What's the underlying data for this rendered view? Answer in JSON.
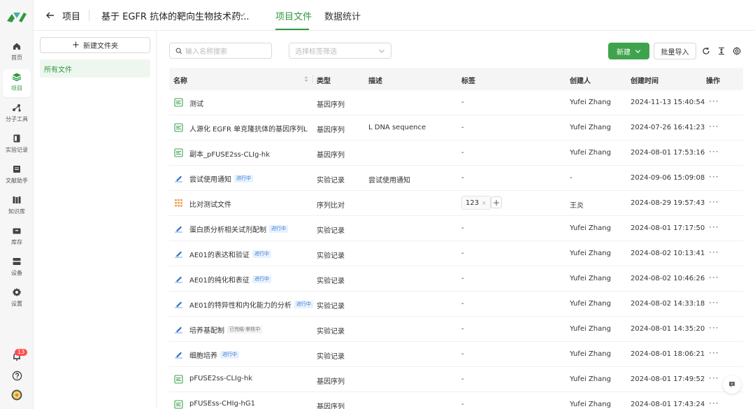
{
  "nav": {
    "items": [
      {
        "label": "首页",
        "icon": "home-icon"
      },
      {
        "label": "项目",
        "icon": "layers-icon"
      },
      {
        "label": "分子工具",
        "icon": "molecule-icon"
      },
      {
        "label": "实验记录",
        "icon": "notebook-icon"
      },
      {
        "label": "文献助手",
        "icon": "book-icon"
      },
      {
        "label": "知识库",
        "icon": "library-icon"
      },
      {
        "label": "库存",
        "icon": "inventory-icon"
      },
      {
        "label": "设备",
        "icon": "device-icon"
      },
      {
        "label": "设置",
        "icon": "settings-icon"
      }
    ],
    "active_index": 1,
    "notification_count": "13"
  },
  "header": {
    "root_label": "项目",
    "project_title": "基于 EGFR 抗体的靶向生物技术药...",
    "tabs": [
      {
        "label": "项目文件",
        "active": true
      },
      {
        "label": "数据统计",
        "active": false
      }
    ]
  },
  "folders": {
    "new_folder_label": "新建文件夹",
    "items": [
      "所有文件"
    ]
  },
  "toolbar": {
    "search_placeholder": "输入名称搜索",
    "tag_filter_placeholder": "选择标签筛选",
    "new_label": "新建",
    "import_label": "批量导入"
  },
  "table": {
    "columns": [
      "名称",
      "类型",
      "描述",
      "标签",
      "创建人",
      "创建时间",
      "操作"
    ],
    "rows": [
      {
        "icon": "sequence",
        "name": "测试",
        "badge": "",
        "type": "基因序列",
        "desc": "",
        "tag": "-",
        "creator": "Yufei Zhang",
        "created": "2024-11-13 15:40:54",
        "action": "···"
      },
      {
        "icon": "sequence",
        "name": "人源化 EGFR 单克隆抗体的基因序列L",
        "badge": "",
        "type": "基因序列",
        "desc": "L DNA sequence",
        "tag": "-",
        "creator": "Yufei Zhang",
        "created": "2024-07-26 16:41:23",
        "action": "···"
      },
      {
        "icon": "sequence",
        "name": "副本_pFUSE2ss-CLIg-hk",
        "badge": "",
        "type": "基因序列",
        "desc": "",
        "tag": "-",
        "creator": "Yufei Zhang",
        "created": "2024-08-01 17:53:16",
        "action": "···"
      },
      {
        "icon": "experiment",
        "name": "尝试使用通知",
        "badge": "进行中",
        "type": "实验记录",
        "desc": "尝试使用通知",
        "tag": "-",
        "creator": "-",
        "created": "2024-09-06 15:09:08",
        "action": "···"
      },
      {
        "icon": "alignment",
        "name": "比对测试文件",
        "badge": "",
        "type": "序列比对",
        "desc": "",
        "tag": "123",
        "creator": "王炎",
        "created": "2024-08-29 19:57:43",
        "action": "···"
      },
      {
        "icon": "experiment",
        "name": "蛋白质分析相关试剂配制",
        "badge": "进行中",
        "type": "实验记录",
        "desc": "",
        "tag": "-",
        "creator": "Yufei Zhang",
        "created": "2024-08-01 17:17:50",
        "action": "···"
      },
      {
        "icon": "experiment",
        "name": "AE01的表达和验证",
        "badge": "进行中",
        "type": "实验记录",
        "desc": "",
        "tag": "-",
        "creator": "Yufei Zhang",
        "created": "2024-08-02 10:13:41",
        "action": "···"
      },
      {
        "icon": "experiment",
        "name": "AE01的纯化和表征",
        "badge": "进行中",
        "type": "实验记录",
        "desc": "",
        "tag": "-",
        "creator": "Yufei Zhang",
        "created": "2024-08-02 10:46:26",
        "action": "···"
      },
      {
        "icon": "experiment",
        "name": "AE01的特异性和内化能力的分析",
        "badge": "进行中",
        "type": "实验记录",
        "desc": "",
        "tag": "-",
        "creator": "Yufei Zhang",
        "created": "2024-08-02 14:33:18",
        "action": "···"
      },
      {
        "icon": "experiment",
        "name": "培养基配制",
        "badge": "已完结·审核中",
        "type": "实验记录",
        "desc": "",
        "tag": "-",
        "creator": "Yufei Zhang",
        "created": "2024-08-01 14:35:20",
        "action": "···"
      },
      {
        "icon": "experiment",
        "name": "细胞培养",
        "badge": "进行中",
        "type": "实验记录",
        "desc": "",
        "tag": "-",
        "creator": "Yufei Zhang",
        "created": "2024-08-01 18:06:21",
        "action": "···"
      },
      {
        "icon": "sequence",
        "name": "pFUSE2ss-CLIg-hk",
        "badge": "",
        "type": "基因序列",
        "desc": "",
        "tag": "-",
        "creator": "Yufei Zhang",
        "created": "2024-08-01 17:49:52",
        "action": "···"
      },
      {
        "icon": "sequence",
        "name": "pFUSEss-CHIg-hG1",
        "badge": "",
        "type": "基因序列",
        "desc": "",
        "tag": "-",
        "creator": "Yufei Zhang",
        "created": "2024-08-01 17:43:24",
        "action": "···"
      }
    ]
  },
  "colors": {
    "accent": "#3fa34d",
    "accent_text": "#2f9a3c",
    "badge_blue": "#3a7bd5",
    "notification": "#ff4d4f"
  }
}
